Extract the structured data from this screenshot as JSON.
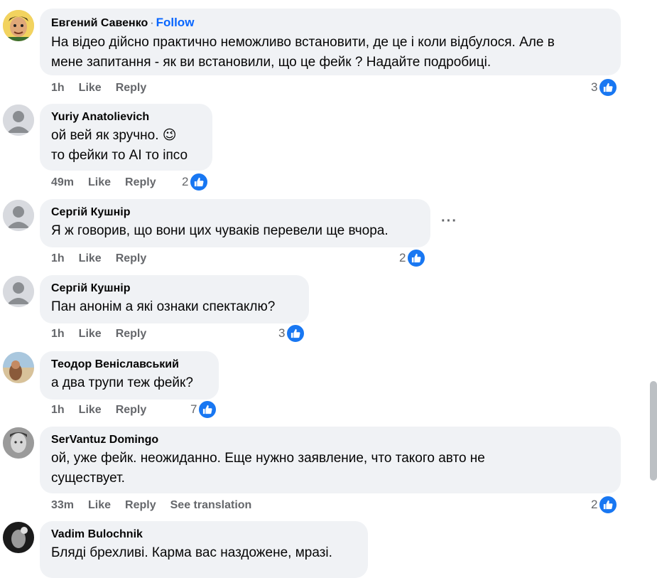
{
  "colors": {
    "bubble": "#f0f2f5",
    "like_blue": "#1877f2",
    "follow_blue": "#0866ff",
    "meta_gray": "#65676b"
  },
  "labels": {
    "like": "Like",
    "reply": "Reply",
    "see_translation": "See translation",
    "follow": "Follow",
    "follow_separator": "·",
    "more": "···"
  },
  "comments": [
    {
      "author": "Евгений Савенко",
      "text": "На відео дійсно практично неможливо встановити, де це і коли відбулося. Але в\nмене запитання - як ви встановили, що це фейк ? Надайте подробиці.",
      "time": "1h",
      "reactions": "3",
      "avatar": "cartoon-face"
    },
    {
      "author": "Yuriy Anatolievich",
      "text": "ой вей як зручно. 😉\nто фейки то AI то іпсо",
      "time": "49m",
      "reactions": "2",
      "avatar": "default-silhouette"
    },
    {
      "author": "Сергій Кушнір",
      "text": "Я ж говорив, що вони цих чуваків перевели ще вчора.",
      "time": "1h",
      "reactions": "2",
      "avatar": "default-silhouette"
    },
    {
      "author": "Сергій Кушнір",
      "text": "Пан анонім а які ознаки спектаклю?",
      "time": "1h",
      "reactions": "3",
      "avatar": "default-silhouette"
    },
    {
      "author": "Теодор Веніславський",
      "text": "а два трупи теж фейк?",
      "time": "1h",
      "reactions": "7",
      "avatar": "beach-photo"
    },
    {
      "author": "SerVantuz Domingo",
      "text": "ой, уже фейк. неожиданно. Еще нужно заявление, что такого авто не\nсуществует.",
      "time": "33m",
      "reactions": "2",
      "avatar": "grayscale-portrait"
    },
    {
      "author": "Vadim Bulochnik",
      "text": "Бляді брехливі. Карма вас наздожене, мразі.",
      "avatar": "dark-portrait"
    }
  ]
}
